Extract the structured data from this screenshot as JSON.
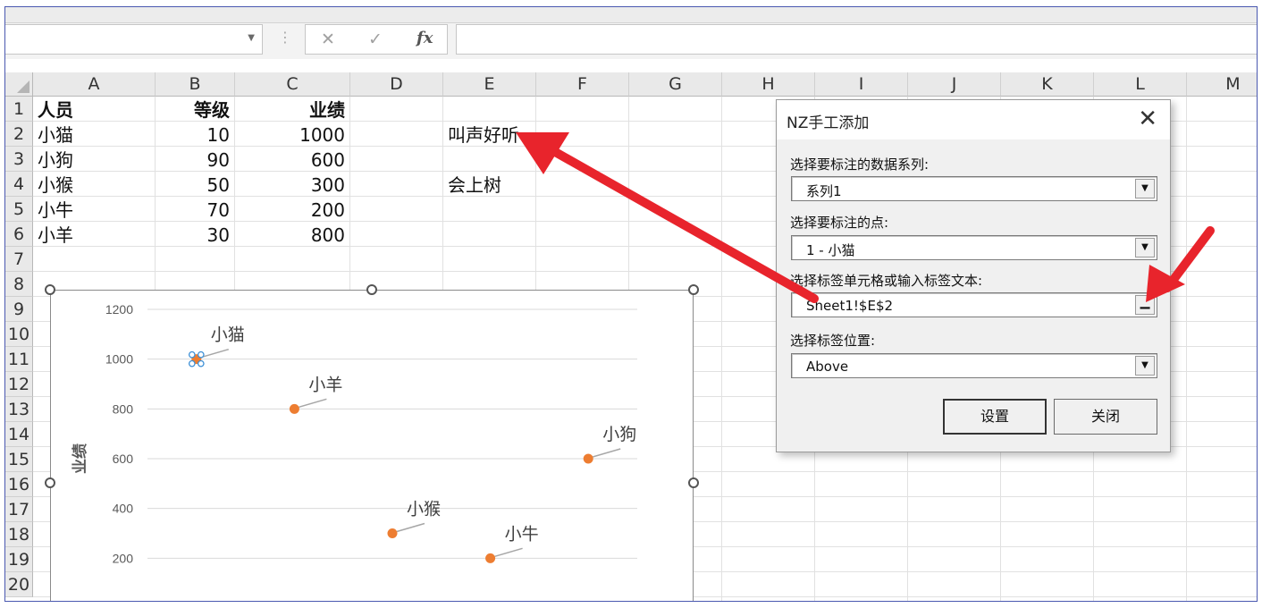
{
  "dialog": {
    "title": "NZ手工添加",
    "series_label": "选择要标注的数据系列:",
    "series_value": "系列1",
    "point_label": "选择要标注的点:",
    "point_value": "1 - 小猫",
    "ref_label": "选择标签单元格或输入标签文本:",
    "ref_value": "Sheet1!$E$2",
    "position_label": "选择标签位置:",
    "position_value": "Above",
    "set_button": "设置",
    "close_button": "关闭"
  },
  "sheet": {
    "columns": [
      "A",
      "B",
      "C",
      "D",
      "E",
      "F",
      "G",
      "H",
      "I",
      "J",
      "K",
      "L",
      "M"
    ],
    "rows": [
      "1",
      "2",
      "3",
      "4",
      "5",
      "6",
      "7",
      "8",
      "9",
      "10",
      "11",
      "12",
      "13",
      "14",
      "15",
      "16",
      "17",
      "18",
      "19",
      "20"
    ],
    "header": [
      "人员",
      "等级",
      "业绩"
    ],
    "data": [
      {
        "name": "小猫",
        "level": "10",
        "perf": "1000"
      },
      {
        "name": "小狗",
        "level": "90",
        "perf": "600"
      },
      {
        "name": "小猴",
        "level": "50",
        "perf": "300"
      },
      {
        "name": "小牛",
        "level": "70",
        "perf": "200"
      },
      {
        "name": "小羊",
        "level": "30",
        "perf": "800"
      }
    ],
    "e2": "叫声好听",
    "e4": "会上树"
  },
  "formula_bar": {
    "fx": "fx",
    "cancel": "✕",
    "enter": "✓"
  },
  "chart_data": {
    "type": "scatter",
    "ylabel": "业绩",
    "ylim": [
      0,
      1200
    ],
    "yticks": [
      200,
      400,
      600,
      800,
      1000,
      1200
    ],
    "xlim": [
      0,
      100
    ],
    "points": [
      {
        "x": 10,
        "y": 1000,
        "label": "小猫",
        "selected": true
      },
      {
        "x": 90,
        "y": 600,
        "label": "小狗"
      },
      {
        "x": 50,
        "y": 300,
        "label": "小猴"
      },
      {
        "x": 70,
        "y": 200,
        "label": "小牛"
      },
      {
        "x": 30,
        "y": 800,
        "label": "小羊"
      }
    ],
    "marker_color": "#ED7D31",
    "grid": true
  },
  "colors": {
    "arrow": "#E8242C",
    "frame": "#4A58B0"
  }
}
